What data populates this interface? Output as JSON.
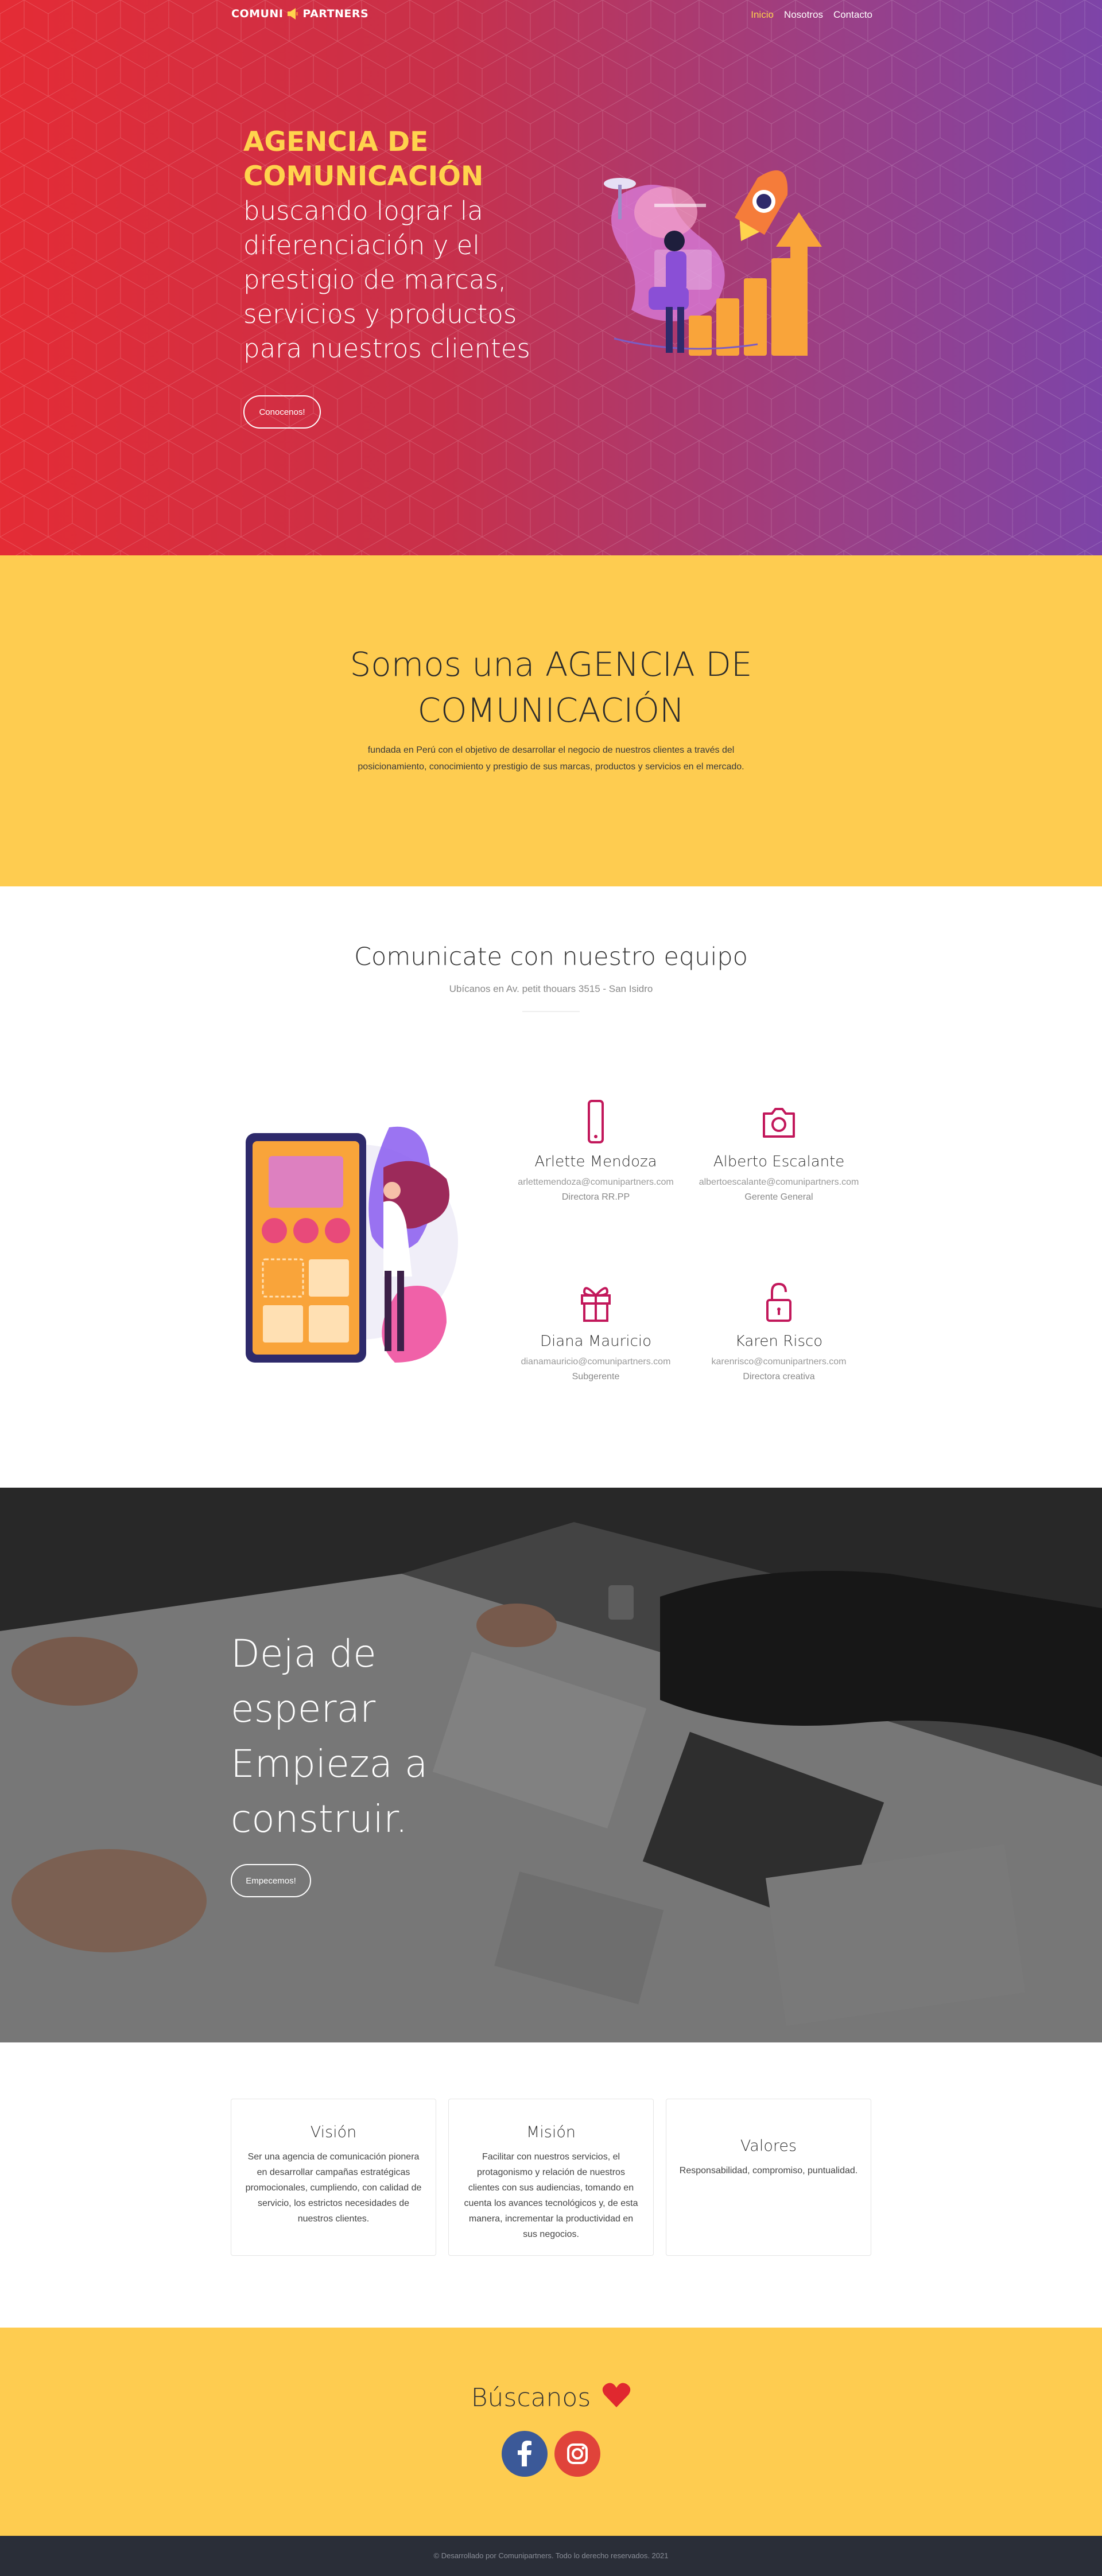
{
  "brand": {
    "left": "COMUNI",
    "right": "PARTNERS"
  },
  "nav": {
    "items": [
      {
        "label": "Inicio"
      },
      {
        "label": "Nosotros"
      },
      {
        "label": "Contacto"
      }
    ]
  },
  "hero": {
    "title": "AGENCIA DE COMUNICACIÓN",
    "subtitle": "buscando lograr la diferenciación y el prestigio de marcas, servicios y productos para nuestros clientes",
    "button": "Conocenos!"
  },
  "about": {
    "title": "Somos una AGENCIA DE COMUNICACIÓN",
    "text": "fundada en Perú con el objetivo de desarrollar el negocio de nuestros clientes a través del posicionamiento, conocimiento y prestigio de sus marcas, productos y servicios en el mercado."
  },
  "team": {
    "title": "Comunicate con nuestro equipo",
    "subtitle": "Ubícanos en Av. petit thouars 3515 - San Isidro",
    "members": [
      {
        "name": "Arlette Mendoza",
        "email": "arlettemendoza@comunipartners.com",
        "role": "Directora RR.PP",
        "icon": "smartphone-icon"
      },
      {
        "name": "Alberto Escalante",
        "email": "albertoescalante@comunipartners.com",
        "role": "Gerente General",
        "icon": "camera-icon"
      },
      {
        "name": "Diana Mauricio",
        "email": "dianamauricio@comunipartners.com",
        "role": "Subgerente",
        "icon": "gift-icon"
      },
      {
        "name": "Karen Risco",
        "email": "karenrisco@comunipartners.com",
        "role": "Directora creativa",
        "icon": "unlock-icon"
      }
    ]
  },
  "cta": {
    "title": "Deja de esperar Empieza a construir.",
    "button": "Empecemos!"
  },
  "values": [
    {
      "title": "Visión",
      "text": "Ser una agencia de comunicación pionera en desarrollar campañas estratégicas promocionales, cumpliendo, con calidad de servicio, los estrictos necesidades de nuestros clientes."
    },
    {
      "title": "Misión",
      "text": "Facilitar con nuestros servicios, el protagonismo y relación de nuestros clientes con sus audiencias, tomando en cuenta los avances tecnológicos y, de esta manera, incrementar la productividad en sus negocios."
    },
    {
      "title": "Valores",
      "text": "Responsabilidad, compromiso, puntualidad."
    }
  ],
  "contact": {
    "title": "Búscanos",
    "social": [
      {
        "name": "facebook-icon",
        "color": "#3b5998"
      },
      {
        "name": "instagram-icon",
        "color": "#e1306c"
      }
    ]
  },
  "footer": {
    "text": "© Desarrollado por Comunipartners. Todo lo derecho reservados. 2021"
  },
  "colors": {
    "accent": "#fecc50",
    "hero_start": "#e42c35",
    "hero_end": "#7d44a8",
    "icon": "#c2185b",
    "footer": "#2a2e38"
  }
}
